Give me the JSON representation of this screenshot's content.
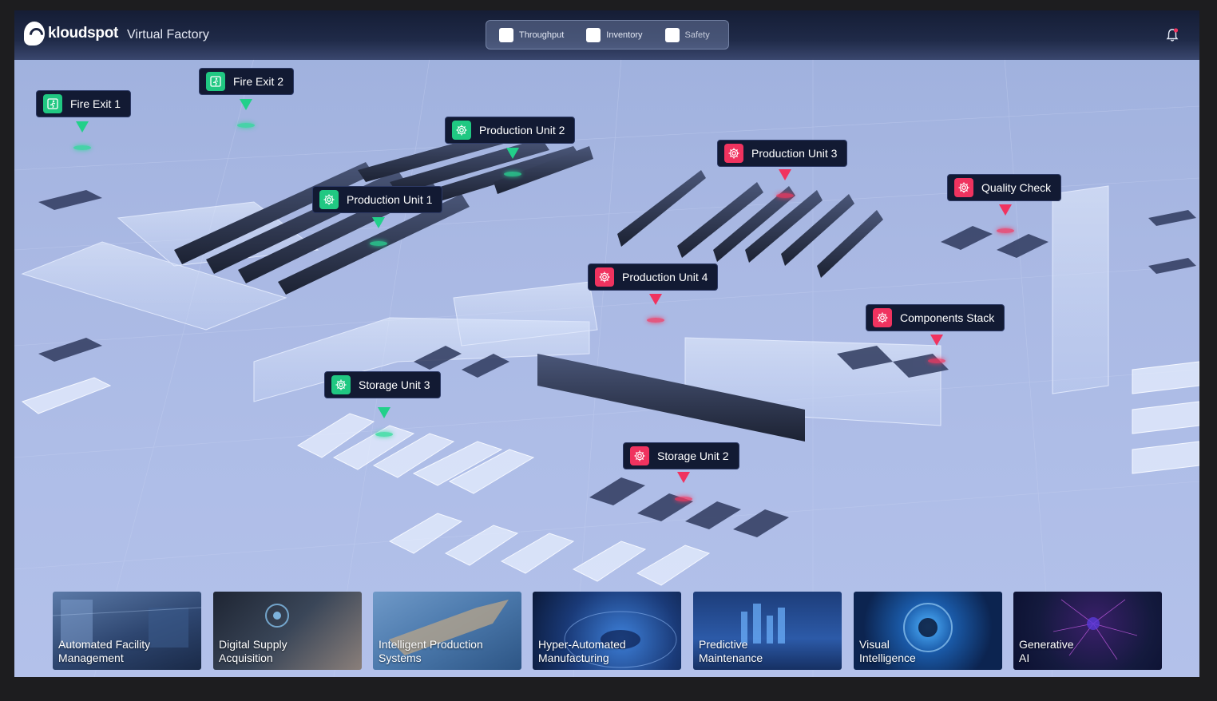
{
  "header": {
    "brand": "kloudspot",
    "app_title": "Virtual Factory"
  },
  "filters": [
    {
      "label": "Throughput",
      "checked": false
    },
    {
      "label": "Inventory",
      "checked": false
    },
    {
      "label": "Safety",
      "checked": false
    }
  ],
  "icons": {
    "bell": "bell-icon",
    "exit": "fire-exit-icon",
    "gear": "gear-icon"
  },
  "markers": [
    {
      "label": "Fire Exit 1",
      "status": "green",
      "icon": "fire-exit-icon"
    },
    {
      "label": "Fire Exit 2",
      "status": "green",
      "icon": "fire-exit-icon"
    },
    {
      "label": "Production Unit 2",
      "status": "green",
      "icon": "gear-icon"
    },
    {
      "label": "Production Unit 3",
      "status": "red",
      "icon": "gear-icon"
    },
    {
      "label": "Production Unit 1",
      "status": "green",
      "icon": "gear-icon"
    },
    {
      "label": "Quality Check",
      "status": "red",
      "icon": "gear-icon"
    },
    {
      "label": "Production Unit 4",
      "status": "red",
      "icon": "gear-icon"
    },
    {
      "label": "Components Stack",
      "status": "red",
      "icon": "gear-icon"
    },
    {
      "label": "Storage Unit 3",
      "status": "green",
      "icon": "gear-icon"
    },
    {
      "label": "Storage Unit 2",
      "status": "red",
      "icon": "gear-icon"
    }
  ],
  "colors": {
    "ok": "#20c882",
    "alert": "#f0335f",
    "tag_bg": "#121a33"
  },
  "cards": [
    {
      "label": "Automated Facility\nManagement"
    },
    {
      "label": "Digital Supply\nAcquisition"
    },
    {
      "label": "Intelligent Production\nSystems"
    },
    {
      "label": "Hyper-Automated\nManufacturing"
    },
    {
      "label": "Predictive\nMaintenance"
    },
    {
      "label": "Visual\nIntelligence"
    },
    {
      "label": "Generative\nAI"
    }
  ]
}
